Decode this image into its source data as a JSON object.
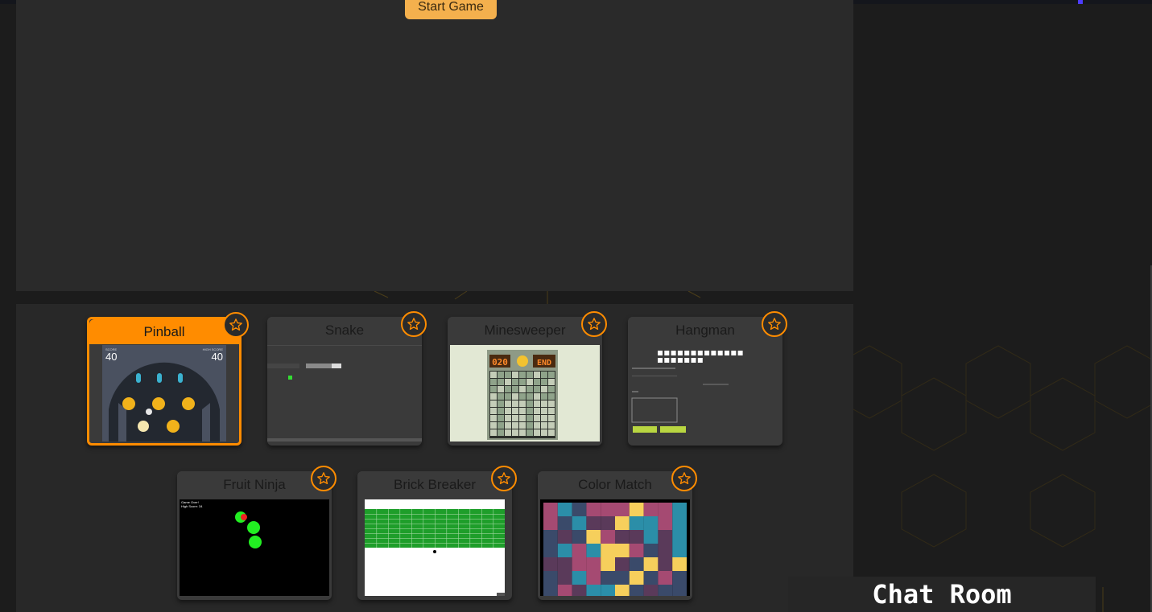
{
  "header": {
    "start_button_label": "Start Game"
  },
  "games": [
    {
      "id": "pinball",
      "title": "Pinball",
      "selected": true,
      "favorite": false,
      "thumb": {
        "score_label": "SCORE",
        "score": "40",
        "highscore_label": "HIGH SCORE",
        "highscore": "40"
      }
    },
    {
      "id": "snake",
      "title": "Snake",
      "selected": false,
      "favorite": false
    },
    {
      "id": "minesweeper",
      "title": "Minesweeper",
      "selected": false,
      "favorite": false,
      "thumb": {
        "counter": "020",
        "end_label": "END"
      }
    },
    {
      "id": "hangman",
      "title": "Hangman",
      "selected": false,
      "favorite": false
    },
    {
      "id": "fruit-ninja",
      "title": "Fruit Ninja",
      "selected": false,
      "favorite": false,
      "thumb": {
        "line1": "Game Over!",
        "line2": "High Score: 34"
      }
    },
    {
      "id": "brick-breaker",
      "title": "Brick Breaker",
      "selected": false,
      "favorite": false
    },
    {
      "id": "color-match",
      "title": "Color Match",
      "selected": false,
      "favorite": false
    }
  ],
  "chat": {
    "title": "Chat Room"
  },
  "colors": {
    "accent": "#ff8c00",
    "start_button": "#f4b04d",
    "panel": "#2a2a2a",
    "card": "#3a3a3a"
  },
  "icons": {
    "favorite": "star-outline-icon"
  }
}
